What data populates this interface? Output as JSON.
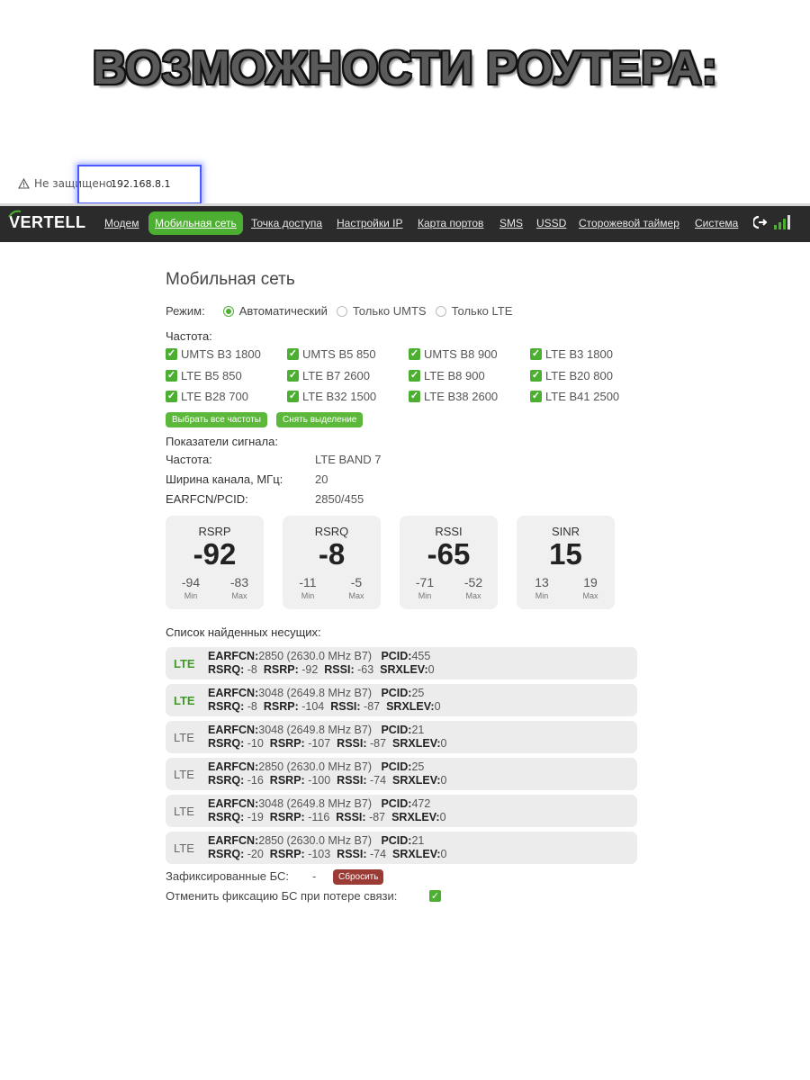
{
  "banner": "ВОЗМОЖНОСТИ РОУТЕРА:",
  "addressbar": {
    "warning": "Не защищено",
    "url": "192.168.8.1"
  },
  "nav": {
    "logo": "VERTELL",
    "items": [
      "Модем",
      "Мобильная сеть",
      "Точка доступа",
      "Настройки IP",
      "Карта портов",
      "SMS",
      "USSD",
      "Сторожевой таймер",
      "Система"
    ]
  },
  "page": {
    "title": "Мобильная сеть",
    "mode_label": "Режим:",
    "modes": [
      {
        "label": "Автоматический",
        "selected": true
      },
      {
        "label": "Только UMTS",
        "selected": false
      },
      {
        "label": "Только LTE",
        "selected": false
      }
    ],
    "freq_title": "Частота:",
    "frequencies": [
      "UMTS B3 1800",
      "UMTS B5 850",
      "UMTS B8 900",
      "LTE B3 1800",
      "LTE B5 850",
      "LTE B7 2600",
      "LTE B8 900",
      "LTE B20 800",
      "LTE B28 700",
      "LTE B32 1500",
      "LTE B38 2600",
      "LTE B41 2500"
    ],
    "btn_select_all": "Выбрать все частоты",
    "btn_clear": "Снять выделение",
    "signal_title": "Показатели сигнала:",
    "signal_kv": [
      {
        "label": "Частота:",
        "value": "LTE BAND 7"
      },
      {
        "label": "Ширина канала, МГц:",
        "value": "20"
      },
      {
        "label": "EARFCN/PCID:",
        "value": "2850/455"
      }
    ],
    "cards": [
      {
        "name": "RSRP",
        "value": "-92",
        "min": "-94",
        "max": "-83"
      },
      {
        "name": "RSRQ",
        "value": "-8",
        "min": "-11",
        "max": "-5"
      },
      {
        "name": "RSSI",
        "value": "-65",
        "min": "-71",
        "max": "-52"
      },
      {
        "name": "SINR",
        "value": "15",
        "min": "13",
        "max": "19"
      }
    ],
    "min_label": "Min",
    "max_label": "Max",
    "carriers_title": "Список найденных несущих:",
    "carriers": [
      {
        "type": "LTE",
        "active": true,
        "earfcn": "2850 (2630.0 MHz B7)",
        "pcid": "455",
        "rsrq": "-8",
        "rsrp": "-92",
        "rssi": "-63",
        "srxlev": "0"
      },
      {
        "type": "LTE",
        "active": true,
        "earfcn": "3048 (2649.8 MHz B7)",
        "pcid": "25",
        "rsrq": "-8",
        "rsrp": "-104",
        "rssi": "-87",
        "srxlev": "0"
      },
      {
        "type": "LTE",
        "active": false,
        "earfcn": "3048 (2649.8 MHz B7)",
        "pcid": "21",
        "rsrq": "-10",
        "rsrp": "-107",
        "rssi": "-87",
        "srxlev": "0"
      },
      {
        "type": "LTE",
        "active": false,
        "earfcn": "2850 (2630.0 MHz B7)",
        "pcid": "25",
        "rsrq": "-16",
        "rsrp": "-100",
        "rssi": "-74",
        "srxlev": "0"
      },
      {
        "type": "LTE",
        "active": false,
        "earfcn": "3048 (2649.8 MHz B7)",
        "pcid": "472",
        "rsrq": "-19",
        "rsrp": "-116",
        "rssi": "-87",
        "srxlev": "0"
      },
      {
        "type": "LTE",
        "active": false,
        "earfcn": "2850 (2630.0 MHz B7)",
        "pcid": "21",
        "rsrq": "-20",
        "rsrp": "-103",
        "rssi": "-74",
        "srxlev": "0"
      }
    ],
    "fixed_label": "Зафиксированные БС:",
    "fixed_value": "-",
    "btn_reset": "Сбросить",
    "unfix_label": "Отменить фиксацию БС при потере связи:"
  },
  "colors": {
    "accent": "#4caf32",
    "navbar": "#2b2b2b",
    "danger": "#9a3b36"
  }
}
